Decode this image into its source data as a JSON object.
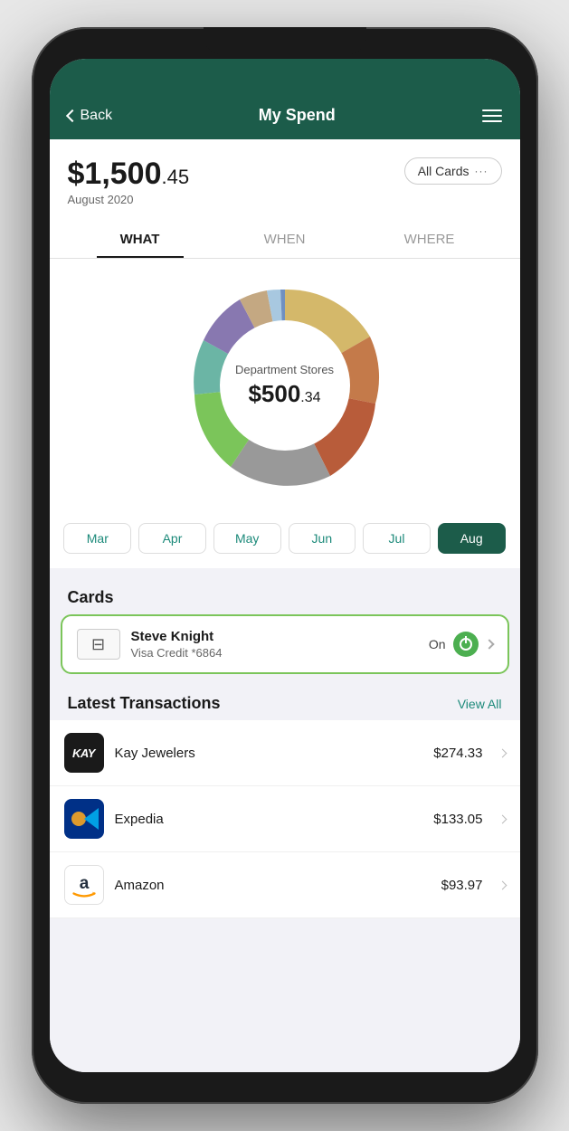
{
  "header": {
    "back_label": "Back",
    "title": "My Spend",
    "menu_icon": "menu-icon"
  },
  "amount": {
    "value": "$1,500",
    "cents": ".45",
    "date": "August 2020"
  },
  "all_cards_button": {
    "label": "All Cards",
    "dots": "···"
  },
  "tabs": [
    {
      "id": "what",
      "label": "WHAT",
      "active": true
    },
    {
      "id": "when",
      "label": "WHEN",
      "active": false
    },
    {
      "id": "where",
      "label": "WHERE",
      "active": false
    }
  ],
  "chart": {
    "center_label": "Department Stores",
    "center_amount": "$500",
    "center_cents": ".34"
  },
  "months": [
    {
      "id": "mar",
      "label": "Mar",
      "active": false
    },
    {
      "id": "apr",
      "label": "Apr",
      "active": false
    },
    {
      "id": "may",
      "label": "May",
      "active": false
    },
    {
      "id": "jun",
      "label": "Jun",
      "active": false
    },
    {
      "id": "jul",
      "label": "Jul",
      "active": false
    },
    {
      "id": "aug",
      "label": "Aug",
      "active": true
    }
  ],
  "cards_section": {
    "title": "Cards",
    "card": {
      "name": "Steve Knight",
      "details": "Visa Credit *6864",
      "status": "On"
    }
  },
  "transactions": {
    "title": "Latest Transactions",
    "view_all": "View All",
    "items": [
      {
        "id": "kay",
        "name": "Kay Jewelers",
        "amount": "$274.33"
      },
      {
        "id": "expedia",
        "name": "Expedia",
        "amount": "$133.05"
      },
      {
        "id": "amazon",
        "name": "Amazon",
        "amount": "$93.97"
      }
    ]
  }
}
